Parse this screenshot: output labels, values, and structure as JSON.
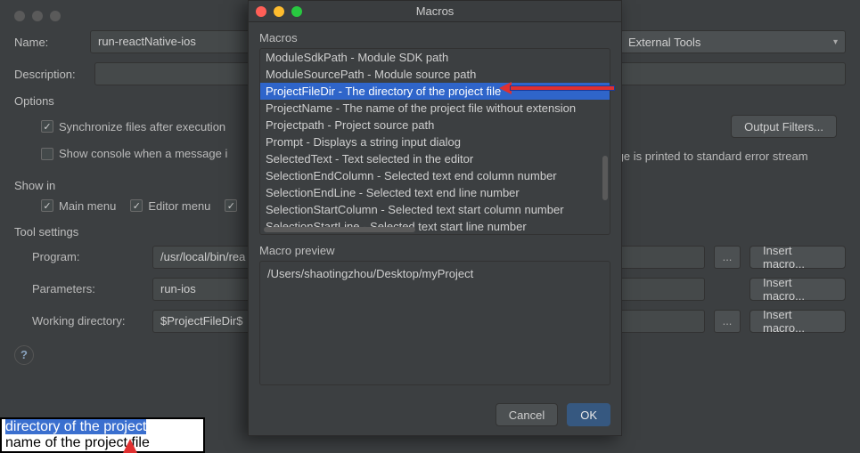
{
  "bg": {
    "name_label": "Name:",
    "name_value": "run-reactNative-ios",
    "category_label": "External Tools",
    "desc_label": "Description:",
    "desc_value": "",
    "options_label": "Options",
    "sync_label": "Synchronize files after execution",
    "show_console_label": "Show console when a message i",
    "show_console_tail": "sage is printed to standard error stream",
    "output_filters": "Output Filters...",
    "showin_label": "Show in",
    "mainmenu": "Main menu",
    "editormenu": "Editor menu",
    "tools_label": "Tool settings",
    "program_label": "Program:",
    "program_value": "/usr/local/bin/rea",
    "params_label": "Parameters:",
    "params_value": "run-ios",
    "workdir_label": "Working directory:",
    "workdir_value": "$ProjectFileDir$",
    "insert_macro": "Insert macro...",
    "browse": "...",
    "strip_line1": "directory of the project",
    "strip_line2": "name of the project file"
  },
  "modal": {
    "title": "Macros",
    "macros_label": "Macros",
    "items": [
      "ModuleSdkPath - Module SDK path",
      "ModuleSourcePath - Module source path",
      "ProjectFileDir - The directory of the project file",
      "ProjectName - The name of the project file without extension",
      "Projectpath - Project source path",
      "Prompt - Displays a string input dialog",
      "SelectedText - Text selected in the editor",
      "SelectionEndColumn - Selected text end column number",
      "SelectionEndLine - Selected text end line number",
      "SelectionStartColumn - Selected text start column number",
      "SelectionStartLine - Selected text start line number"
    ],
    "selected_index": 2,
    "preview_label": "Macro preview",
    "preview_value": "/Users/shaotingzhou/Desktop/myProject",
    "cancel": "Cancel",
    "ok": "OK"
  }
}
